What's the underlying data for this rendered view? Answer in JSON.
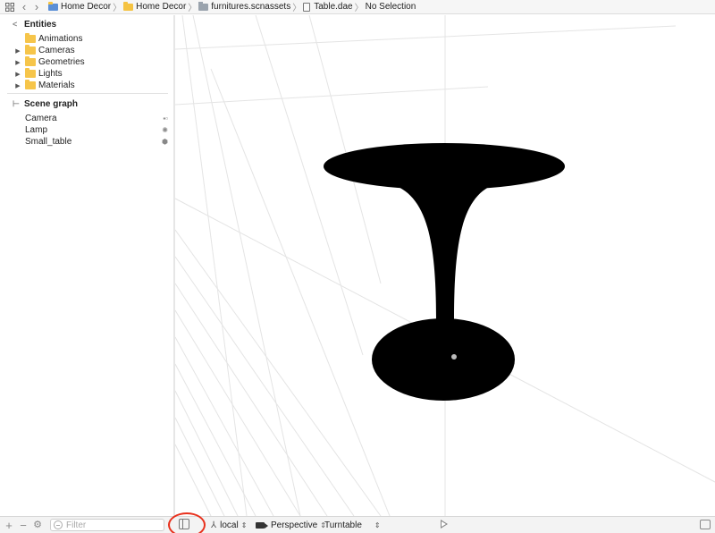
{
  "jumpbar": {
    "crumbs": [
      "Home Decor",
      "Home Decor",
      "furnitures.scnassets",
      "Table.dae",
      "No Selection"
    ]
  },
  "sidebar": {
    "entities_title": "Entities",
    "entities": [
      {
        "label": "Animations",
        "expandable": false
      },
      {
        "label": "Cameras",
        "expandable": true
      },
      {
        "label": "Geometries",
        "expandable": true
      },
      {
        "label": "Lights",
        "expandable": true
      },
      {
        "label": "Materials",
        "expandable": true
      }
    ],
    "scene_graph_title": "Scene graph",
    "nodes": [
      {
        "label": "Camera",
        "icon": "camera-icon"
      },
      {
        "label": "Lamp",
        "icon": "light-icon"
      },
      {
        "label": "Small_table",
        "icon": "geometry-icon"
      }
    ]
  },
  "bottombar": {
    "filter_placeholder": "Filter",
    "space": "local",
    "camera": "Perspective",
    "mode": "Turntable"
  },
  "colors": {
    "highlight": "#e8301c",
    "folder": "#f6c54a",
    "model": "#000000"
  }
}
